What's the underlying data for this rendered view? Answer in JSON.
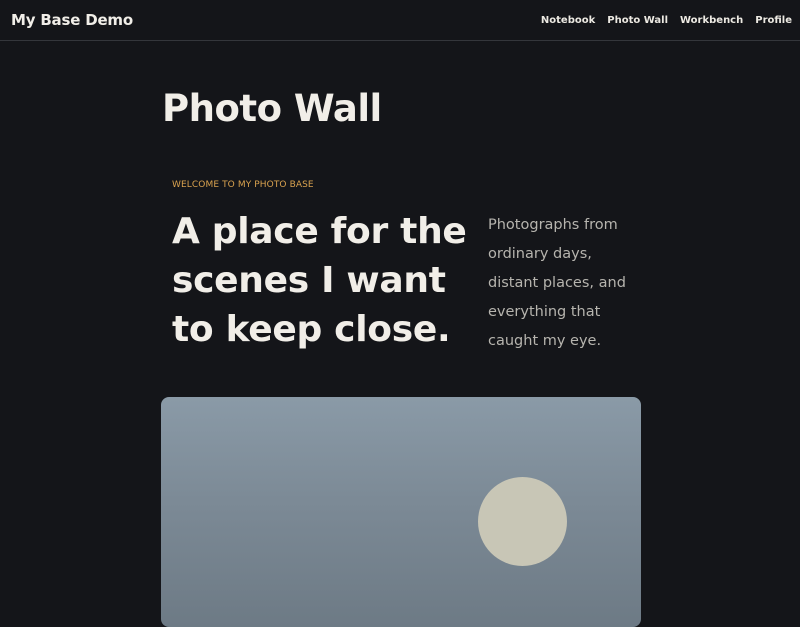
{
  "header": {
    "brand": "My Base Demo",
    "nav": [
      {
        "label": "Notebook"
      },
      {
        "label": "Photo Wall"
      },
      {
        "label": "Workbench"
      },
      {
        "label": "Profile"
      }
    ]
  },
  "main": {
    "page_title": "Photo Wall",
    "eyebrow": "WELCOME TO MY PHOTO BASE",
    "headline": "A place for the scenes I want to keep close.",
    "blurb": "Photographs from ordinary days, distant places, and everything that caught my eye."
  },
  "photo": {
    "sky_color": "#8a9aa7",
    "sun_color": "#c8c6b6"
  }
}
